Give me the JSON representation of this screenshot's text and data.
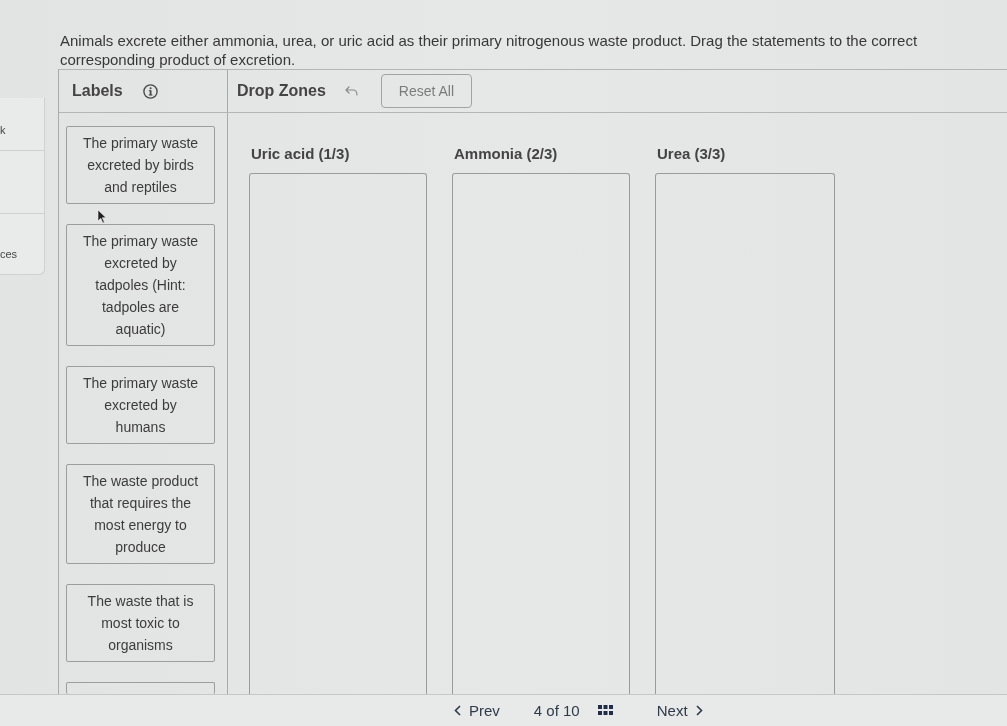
{
  "instructions": "Animals excrete either ammonia, urea, or uric acid as their primary nitrogenous waste product. Drag the statements to the correct corresponding product of excretion.",
  "side_panel": {
    "items": [
      "k",
      "ces"
    ]
  },
  "labels_panel": {
    "title": "Labels"
  },
  "drop_zones_panel": {
    "title": "Drop Zones",
    "reset_button": "Reset All"
  },
  "labels": [
    {
      "kind": "card",
      "text": "The primary waste excreted by birds and reptiles"
    },
    {
      "kind": "card",
      "text": "The primary waste excreted by tadpoles (Hint: tadpoles are aquatic)"
    },
    {
      "kind": "card",
      "text": "The primary waste excreted by humans"
    },
    {
      "kind": "card",
      "text": "The waste product that requires the most energy to produce"
    },
    {
      "kind": "card",
      "text": "The waste that is most toxic to organisms"
    },
    {
      "kind": "cut_off"
    }
  ],
  "drop_zones": [
    {
      "title": "Uric acid (1/3)"
    },
    {
      "title": "Ammonia (2/3)"
    },
    {
      "title": "Urea (3/3)"
    }
  ],
  "pagination": {
    "prev": "Prev",
    "position": "4 of 10",
    "next": "Next"
  }
}
